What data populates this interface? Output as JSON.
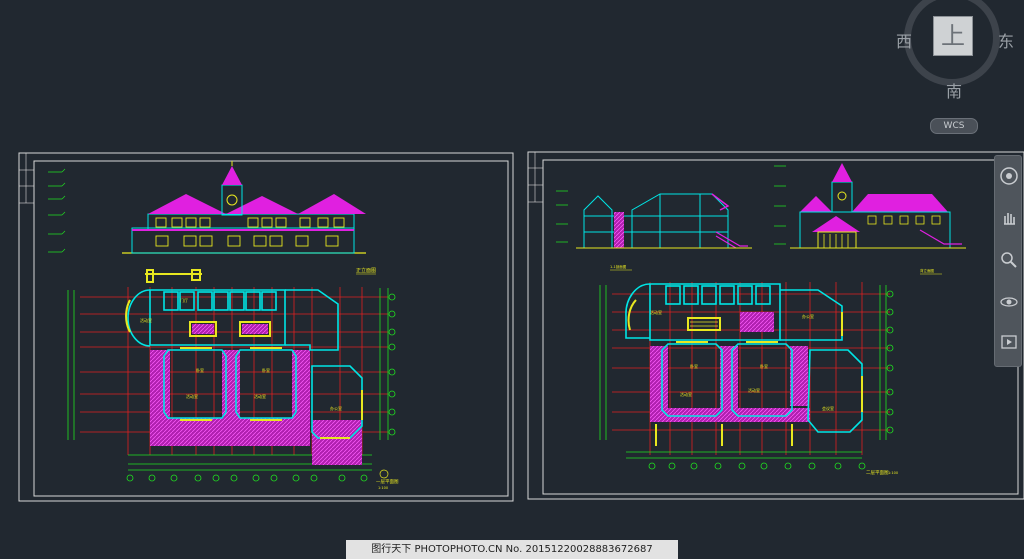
{
  "viewcube": {
    "top_face": "上",
    "west": "西",
    "east": "东",
    "south": "南",
    "wcs": "WCS"
  },
  "sheet_left": {
    "elevation_title": "正立面图",
    "plan_title": "一层平面图",
    "plan_scale": "1:100",
    "rooms": [
      "活动室",
      "卧室",
      "卧室",
      "活动室",
      "活动室",
      "门厅",
      "卫生间"
    ]
  },
  "sheet_right": {
    "elevation_left_title": "1-1剖面图",
    "elevation_right_title": "背立面图",
    "plan_title": "二层平面图",
    "plan_scale": "1:100",
    "rooms": [
      "活动室",
      "卧室",
      "卧室",
      "活动室",
      "活动室",
      "办公室",
      "会议室"
    ]
  },
  "colors": {
    "background": "#212830",
    "wall": "#00e5e5",
    "roof": "#e020e0",
    "axis": "#e02020",
    "dimension": "#20e020",
    "window": "#e8e820"
  },
  "navbar": {
    "buttons": [
      "full-navigation-wheel-icon",
      "pan-icon",
      "zoom-icon",
      "orbit-icon",
      "showmotion-icon"
    ]
  },
  "watermark": {
    "text": "图行天下 PHOTOPHOTO.CN   No. 20151220028883672687"
  }
}
